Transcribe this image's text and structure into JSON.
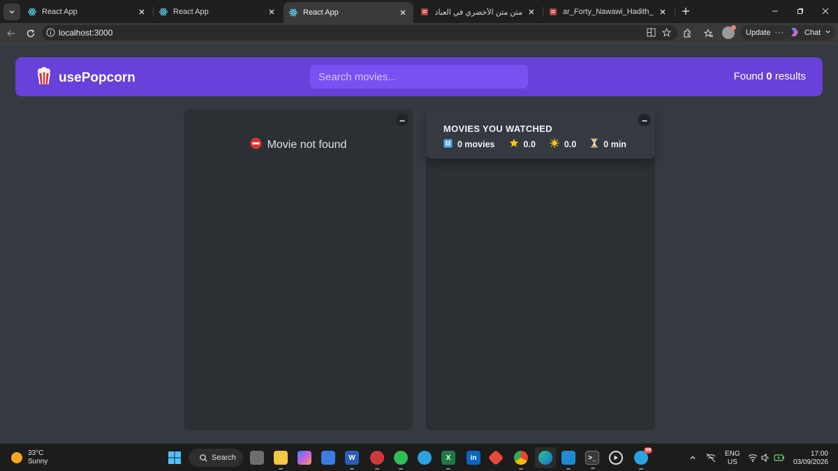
{
  "browser": {
    "tabs": [
      {
        "title": "React App",
        "active": false
      },
      {
        "title": "React App",
        "active": false
      },
      {
        "title": "React App",
        "active": true
      },
      {
        "title": "متن متن الأخضري في العبادات الش",
        "active": false
      },
      {
        "title": "ar_Forty_Nawawi_Hadith_Dar_Alsa",
        "active": false
      }
    ],
    "url": "localhost:3000",
    "update_label": "Update",
    "chat_label": "Chat"
  },
  "app": {
    "logo_emoji": "🍿",
    "logo_text": "usePopcorn",
    "search_placeholder": "Search movies...",
    "results_prefix": "Found",
    "results_count": "0",
    "results_suffix": "results",
    "toggle_label": "–",
    "error_icon": "⛔️",
    "error_text": "Movie not found",
    "summary": {
      "title": "Movies you watched",
      "stats": [
        {
          "icon": "#️⃣",
          "icon_name": "hash-icon",
          "text": "0 movies"
        },
        {
          "icon": "⭐️",
          "icon_name": "star-icon",
          "text": "0.0"
        },
        {
          "icon": "🌟",
          "icon_name": "glowing-star-icon",
          "text": "0.0"
        },
        {
          "icon": "⏳",
          "icon_name": "hourglass-icon",
          "text": "0 min"
        }
      ]
    }
  },
  "taskbar": {
    "weather_temp": "33°C",
    "weather_desc": "Sunny",
    "search_label": "Search",
    "lang_1": "ENG",
    "lang_2": "US",
    "time": "17:00",
    "date": "03/09/2026",
    "telegram_badge": "99"
  },
  "colors": {
    "primary": "#6741d9",
    "primary_light": "#7950f2",
    "background": "#343a40",
    "box": "#2b3035"
  }
}
